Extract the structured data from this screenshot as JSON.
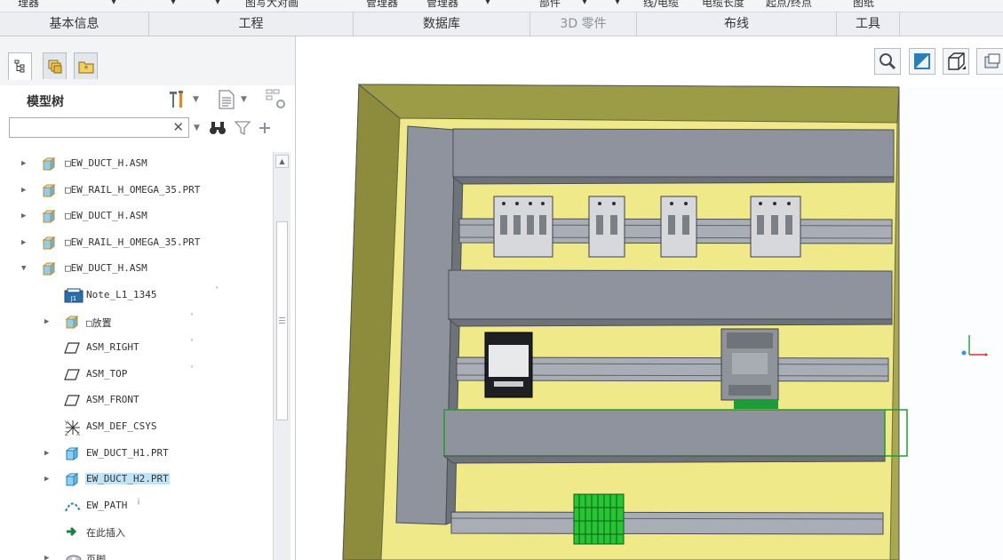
{
  "ribbon": {
    "top_fragments": [
      "理器",
      "▾",
      "▾",
      "▾",
      "图写大对画",
      "管理器",
      "管理器",
      "▾",
      "部件",
      "▾",
      "▾",
      "线/电缆",
      "电缆长度",
      "起点/终点",
      "图纸"
    ],
    "groups": [
      {
        "label": "基本信息",
        "disabled": false
      },
      {
        "label": "工程",
        "disabled": false
      },
      {
        "label": "数据库",
        "disabled": false
      },
      {
        "label": "3D 零件",
        "disabled": true
      },
      {
        "label": "布线",
        "disabled": false
      },
      {
        "label": "工具",
        "disabled": false
      }
    ]
  },
  "panel": {
    "tabs": [
      "model-tree-tab",
      "layers-tab",
      "favorites-tab"
    ],
    "title": "模型树",
    "search": {
      "value": "",
      "placeholder": "",
      "clear": "✕"
    }
  },
  "tree": {
    "items": [
      {
        "name": "tree-item-ew-duct-h-1",
        "label": "□EW_DUCT_H.ASM",
        "expander": "▶",
        "icon": "assembly-icon",
        "indent": 0
      },
      {
        "name": "tree-item-ew-rail-1",
        "label": "□EW_RAIL_H_OMEGA_35.PRT",
        "expander": "▶",
        "icon": "assembly-icon",
        "indent": 0
      },
      {
        "name": "tree-item-ew-duct-h-2",
        "label": "□EW_DUCT_H.ASM",
        "expander": "▶",
        "icon": "assembly-icon",
        "indent": 0
      },
      {
        "name": "tree-item-ew-rail-2",
        "label": "□EW_RAIL_H_OMEGA_35.PRT",
        "expander": "▶",
        "icon": "assembly-icon",
        "indent": 0
      },
      {
        "name": "tree-item-ew-duct-h-3",
        "label": "□EW_DUCT_H.ASM",
        "expander": "▼",
        "icon": "assembly-icon",
        "indent": 0
      },
      {
        "name": "tree-item-note",
        "label": "Note_L1_1345",
        "expander": "",
        "icon": "note-icon",
        "indent": 1,
        "tick": "'"
      },
      {
        "name": "tree-item-placement",
        "label": "□放置",
        "expander": "▶",
        "icon": "assembly-icon",
        "indent": 1,
        "tick": "'"
      },
      {
        "name": "tree-item-asm-right",
        "label": "ASM_RIGHT",
        "expander": "",
        "icon": "datum-plane-icon",
        "indent": 1,
        "tick": "'"
      },
      {
        "name": "tree-item-asm-top",
        "label": "ASM_TOP",
        "expander": "",
        "icon": "datum-plane-icon",
        "indent": 1,
        "tick": "'"
      },
      {
        "name": "tree-item-asm-front",
        "label": "ASM_FRONT",
        "expander": "",
        "icon": "datum-plane-icon",
        "indent": 1
      },
      {
        "name": "tree-item-asm-def-csys",
        "label": "ASM_DEF_CSYS",
        "expander": "",
        "icon": "csys-icon",
        "indent": 1
      },
      {
        "name": "tree-item-ew-duct-h1",
        "label": "EW_DUCT_H1.PRT",
        "expander": "▶",
        "icon": "part-icon",
        "indent": 1
      },
      {
        "name": "tree-item-ew-duct-h2",
        "label": "EW_DUCT_H2.PRT",
        "expander": "▶",
        "icon": "part-icon",
        "indent": 1,
        "selected": true
      },
      {
        "name": "tree-item-ew-path",
        "label": "EW_PATH",
        "expander": "",
        "icon": "path-icon",
        "indent": 1,
        "tick": "¡"
      },
      {
        "name": "tree-item-insert-here",
        "label": "在此插入",
        "expander": "",
        "icon": "insert-arrow-icon",
        "indent": 1
      },
      {
        "name": "tree-item-footer",
        "label": "页脚",
        "expander": "▶",
        "icon": "footer-icon",
        "indent": 1
      }
    ]
  },
  "viewport": {
    "toolbar": [
      "zoom-icon",
      "refit-icon",
      "view-cube-icon",
      "saved-views-icon"
    ],
    "colors": {
      "cabinet": "#efe98a",
      "cabinet_wall": "#8c8c3c",
      "duct": "#8e939d",
      "rail": "#a9aeb6",
      "terminal": "#27c433"
    }
  }
}
